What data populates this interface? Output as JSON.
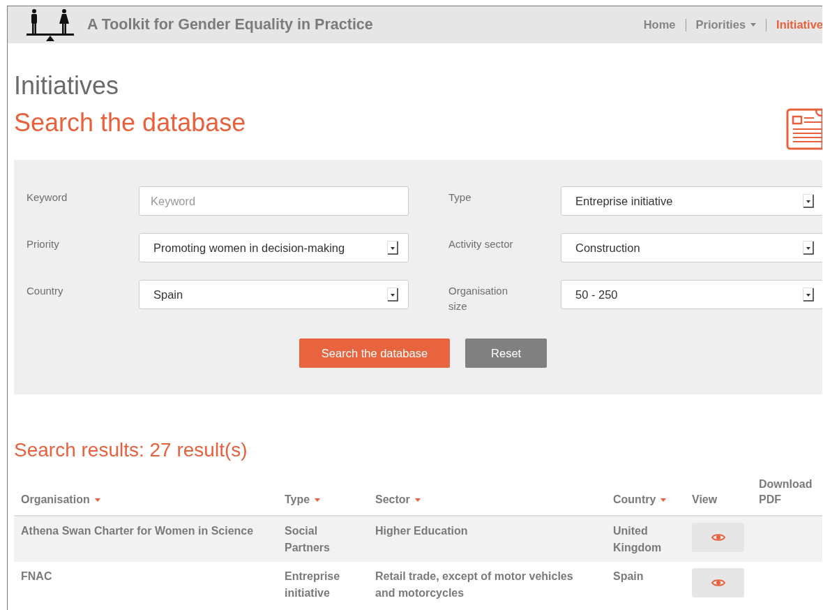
{
  "header": {
    "site_title": "A Toolkit for Gender Equality in Practice",
    "nav": [
      {
        "label": "Home",
        "selected": false,
        "has_menu": false
      },
      {
        "label": "Priorities",
        "selected": false,
        "has_menu": true
      },
      {
        "label": "Initiative",
        "selected": true,
        "has_menu": false
      }
    ]
  },
  "page_title": "Initiatives",
  "search_title": "Search the database",
  "form": {
    "fields": [
      {
        "label": "Keyword",
        "kind": "text",
        "placeholder": "Keyword"
      },
      {
        "label": "Type",
        "kind": "select",
        "value": "Entreprise initiative"
      },
      {
        "label": "Priority",
        "kind": "select",
        "value": "Promoting women in decision-making"
      },
      {
        "label": "Activity sector",
        "kind": "select",
        "value": "Construction"
      },
      {
        "label": "Country",
        "kind": "select",
        "value": "Spain"
      },
      {
        "label": "Organisation size",
        "kind": "select",
        "value": "50 - 250"
      }
    ],
    "buttons": [
      {
        "label": "Search the database",
        "kind": "primary"
      },
      {
        "label": "Reset",
        "kind": "secondary"
      }
    ]
  },
  "results_title": "Search results: 27 result(s)",
  "table": {
    "columns": [
      {
        "label": "Organisation",
        "sortable": true
      },
      {
        "label": "Type",
        "sortable": true
      },
      {
        "label": "Sector",
        "sortable": true
      },
      {
        "label": "Country",
        "sortable": true
      },
      {
        "label": "View",
        "sortable": false
      },
      {
        "label": "Download PDF",
        "sortable": false
      }
    ],
    "rows": [
      {
        "organisation": "Athena Swan Charter for Women in Science",
        "type": "Social Partners",
        "sector": "Higher Education",
        "country": "United Kingdom"
      },
      {
        "organisation": "FNAC",
        "type": "Entreprise initiative",
        "sector": "Retail trade, except of motor vehicles and motorcycles",
        "country": "Spain"
      }
    ]
  }
}
